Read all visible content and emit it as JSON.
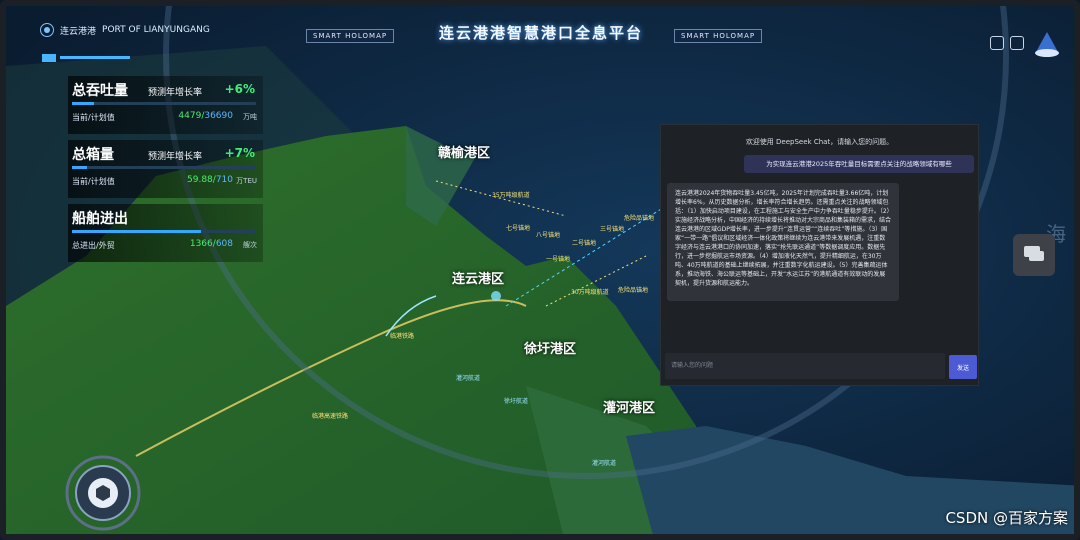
{
  "header": {
    "brand_cn": "连云港港",
    "brand_en": "PORT OF LIANYUNGANG",
    "title": "连云港港智慧港口全息平台",
    "tag_left": "SMART HOLOMAP",
    "tag_right": "SMART HOLOMAP"
  },
  "metrics": [
    {
      "title": "总吞吐量",
      "rate_label": "预测年增长率",
      "rate": "+6%",
      "sub_label": "当前/计划值",
      "current": "4479",
      "plan": "36690",
      "unit": "万吨",
      "progress": 0.12
    },
    {
      "title": "总箱量",
      "rate_label": "预测年增长率",
      "rate": "+7%",
      "sub_label": "当前/计划值",
      "current": "59.88",
      "plan": "710",
      "unit": "万TEU",
      "progress": 0.08
    },
    {
      "title": "船舶进出",
      "rate_label": "",
      "rate": "",
      "sub_label": "总进出/外贸",
      "current": "1366",
      "plan": "608",
      "unit": "艘次",
      "progress": 0.7
    }
  ],
  "map_labels": {
    "ganyu": "赣榆港区",
    "lianyun": "连云港区",
    "xuwei": "徐圩港区",
    "guanhe": "灌河港区",
    "channel_35": "35万吨级航道",
    "anch7": "七号锚地",
    "anch8": "八号锚地",
    "anch2": "二号锚地",
    "anch3": "三号锚地",
    "anch1": "一号锚地",
    "anch_hazard": "危险品锚地",
    "channel_30": "30万吨级航道",
    "anch_haz2": "危险品锚地",
    "railway": "临港铁路",
    "ch_guanhe": "灌河航道",
    "ch_xuwei": "徐圩航道",
    "ch_guanhe2": "灌河航道",
    "rail_bottom": "临港高速铁路",
    "sea": "海"
  },
  "chat": {
    "welcome": "欢迎使用 DeepSeek Chat，请输入您的问题。",
    "user_message": "为实现连云港港2025年吞吐量目标需要点关注的战略领域有哪些",
    "bot_reply": "连云港港2024年货物吞吐量3.45亿吨，2025年计划完成吞吐量3.66亿吨，计划增长率6%，从历史数据分析，增长率符合增长趋势。还需重点关注的战略领域包括：（1）加快启动项目建设，在工程施工与安全生产中力争吞吐量稳步提升。（2）实施经济战略分析，中国经济的持续增长将推动对大宗商品和集装箱的需求，结合连云港港的区域GDP增长率，进一步提升“连贯运营”“连续吞吐”等措施。（3）国家“一带一路”倡议和区域经济一体化政策将继续为连云港带来发展机遇，注重数字经济与连云港港口的协同加速，落实“抢先联运通道”等数据调度应用。数据先行，进一步挖掘航运市场资源。（4）增加液化天然气，提升精细航运，在30万吨、40万吨航道的基础上继续拓展，并注重数字化航运建设。（5）完善集疏运体系，推动海铁、海公联运等基础上，开发“水运江苏”的港航通道有效联动的发展契机，提升货源和航运能力。",
    "input_placeholder": "请输入您的问题",
    "send_label": "发送"
  },
  "watermark": "CSDN @百家方案"
}
